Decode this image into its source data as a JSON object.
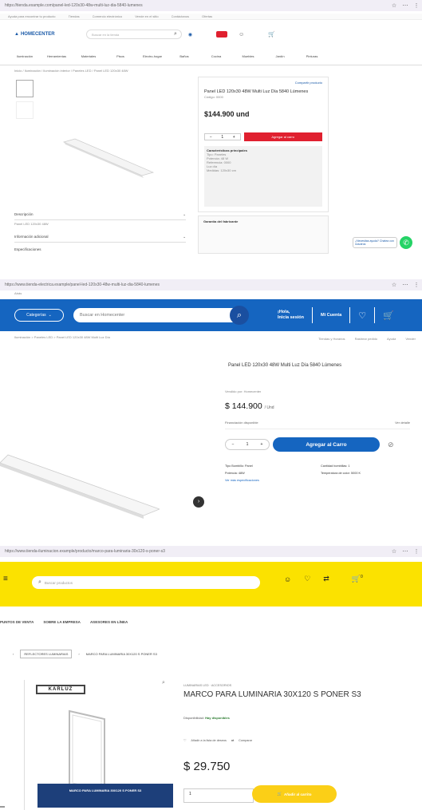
{
  "colors": {
    "red": "#e0202f",
    "blue": "#1565c0",
    "yellow": "#fbe200",
    "whatsapp": "#25d366",
    "gold": "#fbcf17"
  },
  "store1": {
    "chrome_url": "https://tienda.example.com/panel-led-120x30-48w-multi-luz-dia-5840-lumenes",
    "top_nav": [
      "Ayuda para encontrar tu producto",
      "Tiendas",
      "Comercio electrónico",
      "Vende en el sitio",
      "Contáctanos",
      "Ofertas"
    ],
    "logo": "HOMECENTER",
    "search_placeholder": "Buscar en la tienda",
    "categories": [
      "Iluminación",
      "Herramientas",
      "Materiales",
      "Pisos",
      "Electro-hogar",
      "Baños",
      "Cocina",
      "Muebles",
      "Jardín",
      "Pinturas"
    ],
    "crumbs": "Inicio / Iluminación / Iluminación interior / Paneles LED / Panel LED 120x30 48W",
    "panel_link": "Compartir producto",
    "product_title": "Panel LED 120x30 48W Multi Luz Día 5840 Lúmenes",
    "sku": "Código: 0000",
    "price": "$144.900 und",
    "qty": "1",
    "add_label": "Agregar al carro",
    "features_title": "Características principales",
    "features": [
      "Tipo: Paneles",
      "Potencia: 48 W",
      "Referencia: 0000",
      "Luz día",
      "Medidas: 120x30 cm"
    ],
    "accordions": [
      "Descripción",
      "Información adicional",
      "Especificaciones"
    ],
    "acc_sub": "Panel LED 120x30 48W",
    "promo_title": "Garantía del fabricante",
    "chat_label": "¿Necesitas ayuda? Chatea con nosotros"
  },
  "store2": {
    "chrome_url": "https://www.tienda-electrica.example/panel-led-120x30-48w-multi-luz-dia-5840-lumenes",
    "tab_label": "Atrás",
    "cat_button": "Categorías",
    "search_placeholder": "Buscar en Homecenter",
    "hello": "¡Hola,",
    "hello_sub": "Inicia sesión",
    "mi_cuenta": "Mi Cuenta",
    "subnav": [
      "Tiendas y Horarios",
      "Rastrear pedido",
      "Ayuda",
      "Vender"
    ],
    "crumbs": "Iluminación > Paneles LED > Panel LED 120x30 48W Multi Luz Día",
    "title": "Panel LED 120x30 48W Multi Luz Día 5840 Lúmenes",
    "seller": "Vendido por: Homecenter",
    "price": "$ 144.900",
    "price_unit": "/ Und",
    "installment": "Financiación disponible",
    "installment_right": "Ver detalle",
    "qty": "1",
    "add_label": "Agregar al Carro",
    "specs": [
      "Tipo Bombillo: Panel",
      "Cantidad bombillas: 1",
      "Potencia: 48W",
      "Temperatura de color: 5000 K"
    ],
    "specs_more": "Ver más especificaciones"
  },
  "store3": {
    "chrome_url": "https://www.tienda-iluminacion.example/producto/marco-para-luminaria-30x120-s-poner-s3",
    "search_placeholder": "Buscar productos",
    "cart_count": "0",
    "menu": [
      "PUNTOS DE VENTA",
      "SOBRE LA EMPRESA",
      "ASESORES EN LÍNEA"
    ],
    "crumbs": [
      "",
      "REFLECTORES LUMINARIAS",
      "MARCO PARA LUMINARIA 30X120 S PONER S3"
    ],
    "brand": "KARLUZ",
    "banner_text": "MARCO PARA LUMINARIA 30X120 S PONER S3",
    "category": "LUMINARIAS LED · ACCESORIOS",
    "title": "MARCO PARA LUMINARIA 30X120 S PONER S3",
    "availability_label": "Disponibilidad:",
    "availability_value": "Hay disponibles",
    "wishlist": "Añadir a la lista de deseos",
    "compare": "Comparar",
    "price": "$ 29.750",
    "qty": "1",
    "add_label": "Añadir al carrito"
  }
}
